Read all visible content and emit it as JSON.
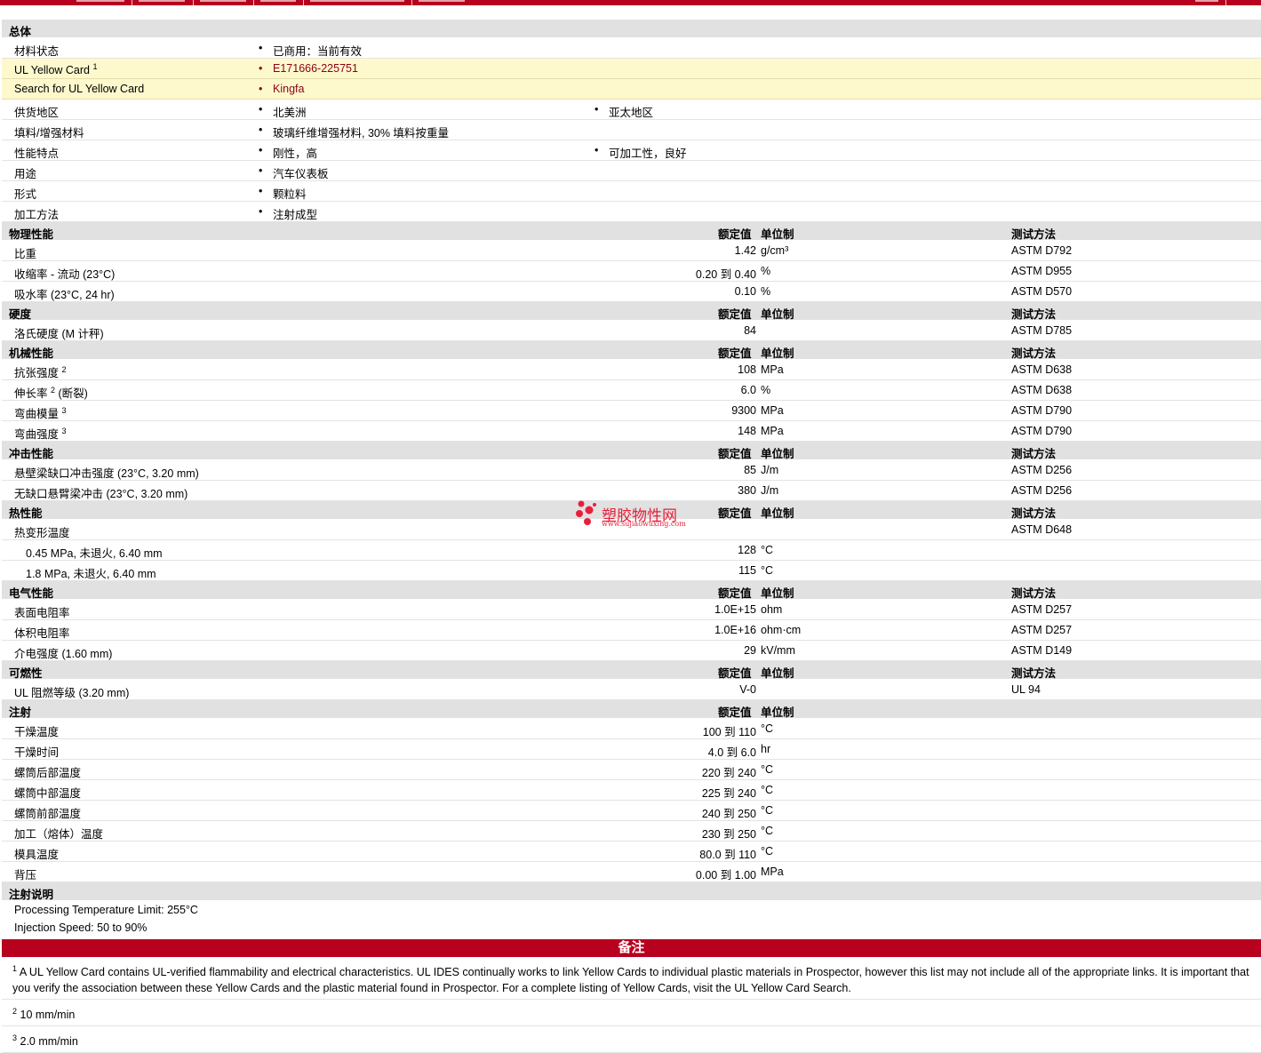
{
  "colors": {
    "accent": "#b8001f",
    "section_bg": "#e1e1e1",
    "highlight_bg": "#fdf9cd",
    "link": "#8b0013",
    "watermark": "#e8203a"
  },
  "headers": {
    "nominal": "额定值",
    "unit": "单位制",
    "method": "测试方法"
  },
  "general": {
    "title": "总体",
    "rows": [
      {
        "label": "材料状态",
        "items": [
          "已商用：当前有效"
        ]
      },
      {
        "label": "UL Yellow Card",
        "sup": "1",
        "items": [
          "E171666-225751"
        ],
        "highlight": true
      },
      {
        "label": "Search for UL Yellow Card",
        "items": [
          "Kingfa"
        ],
        "highlight": true
      },
      {
        "label": "供货地区",
        "items": [
          "北美洲",
          "亚太地区"
        ]
      },
      {
        "label": "填料/增强材料",
        "items": [
          "玻璃纤维增强材料, 30% 填料按重量"
        ]
      },
      {
        "label": "性能特点",
        "items": [
          "刚性，高",
          "可加工性，良好"
        ]
      },
      {
        "label": "用途",
        "items": [
          "汽车仪表板"
        ]
      },
      {
        "label": "形式",
        "items": [
          "颗粒料"
        ]
      },
      {
        "label": "加工方法",
        "items": [
          "注射成型"
        ]
      }
    ]
  },
  "sections": [
    {
      "title": "物理性能",
      "show_method": true,
      "rows": [
        {
          "label": "比重",
          "value": "1.42",
          "unit": "g/cm³",
          "method": "ASTM D792"
        },
        {
          "label": "收缩率  - 流动  (23°C)",
          "value": "0.20 到  0.40",
          "unit": "%",
          "method": "ASTM D955"
        },
        {
          "label": "吸水率  (23°C, 24 hr)",
          "value": "0.10",
          "unit": "%",
          "method": "ASTM D570"
        }
      ]
    },
    {
      "title": "硬度",
      "show_method": true,
      "rows": [
        {
          "label": "洛氏硬度  (M 计秤)",
          "value": "84",
          "unit": "",
          "method": "ASTM D785"
        }
      ]
    },
    {
      "title": "机械性能",
      "show_method": true,
      "rows": [
        {
          "label": "抗张强度",
          "sup": "2",
          "value": "108",
          "unit": "MPa",
          "method": "ASTM D638"
        },
        {
          "label": "伸长率",
          "sup": "2",
          "suffix": " (断裂)",
          "value": "6.0",
          "unit": "%",
          "method": "ASTM D638"
        },
        {
          "label": "弯曲模量",
          "sup": "3",
          "value": "9300",
          "unit": "MPa",
          "method": "ASTM D790"
        },
        {
          "label": "弯曲强度",
          "sup": "3",
          "value": "148",
          "unit": "MPa",
          "method": "ASTM D790"
        }
      ]
    },
    {
      "title": "冲击性能",
      "show_method": true,
      "rows": [
        {
          "label": "悬壁梁缺口冲击强度  (23°C, 3.20 mm)",
          "value": "85",
          "unit": "J/m",
          "method": "ASTM D256"
        },
        {
          "label": "无缺口悬臂梁冲击  (23°C, 3.20 mm)",
          "value": "380",
          "unit": "J/m",
          "method": "ASTM D256"
        }
      ]
    },
    {
      "title": "热性能",
      "show_method": true,
      "rows": [
        {
          "label": "热变形温度",
          "value": "",
          "unit": "",
          "method": "ASTM D648"
        },
        {
          "label": "0.45 MPa, 未退火, 6.40 mm",
          "sub": true,
          "value": "128",
          "unit": "°C",
          "method": ""
        },
        {
          "label": "1.8 MPa, 未退火, 6.40 mm",
          "sub": true,
          "value": "115",
          "unit": "°C",
          "method": ""
        }
      ]
    },
    {
      "title": "电气性能",
      "show_method": true,
      "rows": [
        {
          "label": "表面电阻率",
          "value": "1.0E+15",
          "unit": "ohm",
          "method": "ASTM D257"
        },
        {
          "label": "体积电阻率",
          "value": "1.0E+16",
          "unit": "ohm·cm",
          "method": "ASTM D257"
        },
        {
          "label": "介电强度  (1.60 mm)",
          "value": "29",
          "unit": "kV/mm",
          "method": "ASTM D149"
        }
      ]
    },
    {
      "title": "可燃性",
      "show_method": true,
      "rows": [
        {
          "label": "UL 阻燃等级  (3.20 mm)",
          "value": "V-0",
          "unit": "",
          "method": "UL 94"
        }
      ]
    },
    {
      "title": "注射",
      "show_method": false,
      "rows": [
        {
          "label": "干燥温度",
          "value": "100 到  110",
          "unit": "°C",
          "method": ""
        },
        {
          "label": "干燥时间",
          "value": "4.0 到  6.0",
          "unit": "hr",
          "method": ""
        },
        {
          "label": "螺筒后部温度",
          "value": "220 到  240",
          "unit": "°C",
          "method": ""
        },
        {
          "label": "螺筒中部温度",
          "value": "225 到  240",
          "unit": "°C",
          "method": ""
        },
        {
          "label": "螺筒前部温度",
          "value": "240 到  250",
          "unit": "°C",
          "method": ""
        },
        {
          "label": "加工（熔体）温度",
          "value": "230 到  250",
          "unit": "°C",
          "method": ""
        },
        {
          "label": "模具温度",
          "value": "80.0 到  110",
          "unit": "°C",
          "method": ""
        },
        {
          "label": "背压",
          "value": "0.00 到  1.00",
          "unit": "MPa",
          "method": ""
        }
      ]
    }
  ],
  "injection_notes": {
    "title": "注射说明",
    "lines": [
      "Processing Temperature Limit: 255°C",
      "Injection Speed: 50 to 90%"
    ]
  },
  "notes": {
    "title": "备注",
    "footnotes": [
      {
        "num": "1",
        "text": "A UL Yellow Card contains UL-verified flammability and electrical characteristics. UL IDES continually works to link Yellow Cards to individual plastic materials in Prospector, however this list may not include all of the appropriate links. It is important that you verify the association between these Yellow Cards and the plastic material found in Prospector. For a complete listing of Yellow Cards, visit the UL Yellow Card Search."
      },
      {
        "num": "2",
        "text": "10 mm/min"
      },
      {
        "num": "3",
        "text": "2.0 mm/min"
      }
    ]
  },
  "watermark": {
    "title": "塑胶物性网",
    "url": "www.sujiaowuxing.com"
  }
}
